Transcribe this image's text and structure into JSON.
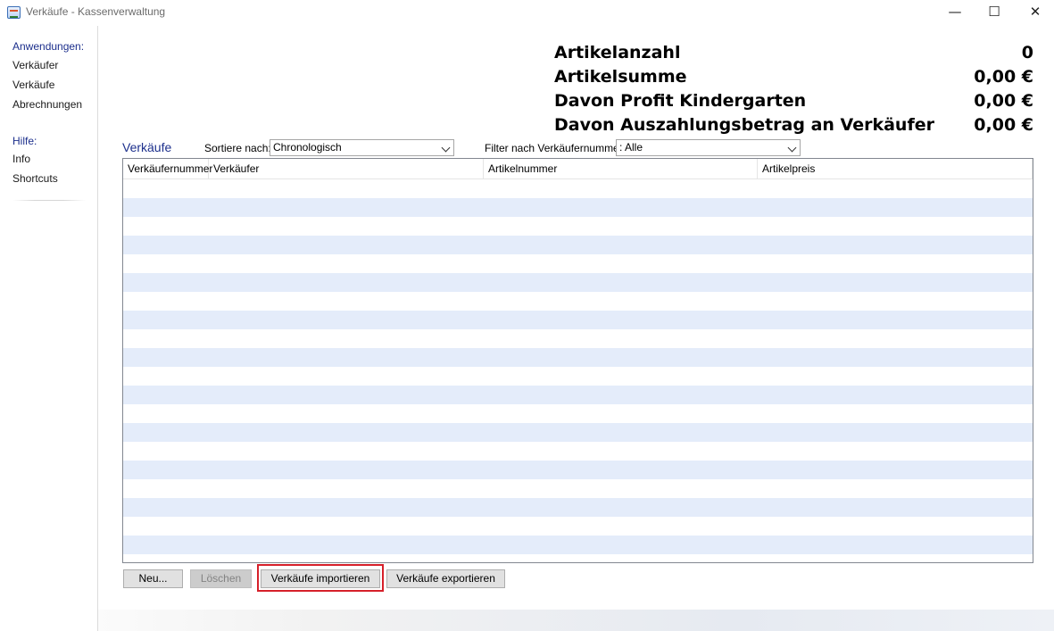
{
  "window": {
    "title": "Verkäufe - Kassenverwaltung",
    "minimize": "—",
    "maximize": "☐",
    "close": "✕"
  },
  "sidebar": {
    "applications_heading": "Anwendungen:",
    "applications": [
      "Verkäufer",
      "Verkäufe",
      "Abrechnungen"
    ],
    "help_heading": "Hilfe:",
    "help": [
      "Info",
      "Shortcuts"
    ]
  },
  "summary": [
    {
      "label": "Artikelanzahl",
      "value": "0"
    },
    {
      "label": "Artikelsumme",
      "value": "0,00 €"
    },
    {
      "label": "Davon Profit Kindergarten",
      "value": "0,00 €"
    },
    {
      "label": "Davon Auszahlungsbetrag an Verkäufer",
      "value": "0,00 €"
    }
  ],
  "sales": {
    "title": "Verkäufe",
    "sort_label": "Sortiere nach:",
    "sort_value": "Chronologisch",
    "filter_label": "Filter nach Verkäufernummer:",
    "filter_value": ": Alle",
    "columns": [
      "Verkäufernummer",
      "Verkäufer",
      "Artikelnummer",
      "Artikelpreis"
    ]
  },
  "buttons": {
    "new": "Neu...",
    "delete": "Löschen",
    "import": "Verkäufe importieren",
    "export": "Verkäufe exportieren"
  },
  "colors": {
    "accent_text": "#1c2f8c",
    "row_alt": "#e4ecfa",
    "highlight": "#d6202a"
  }
}
